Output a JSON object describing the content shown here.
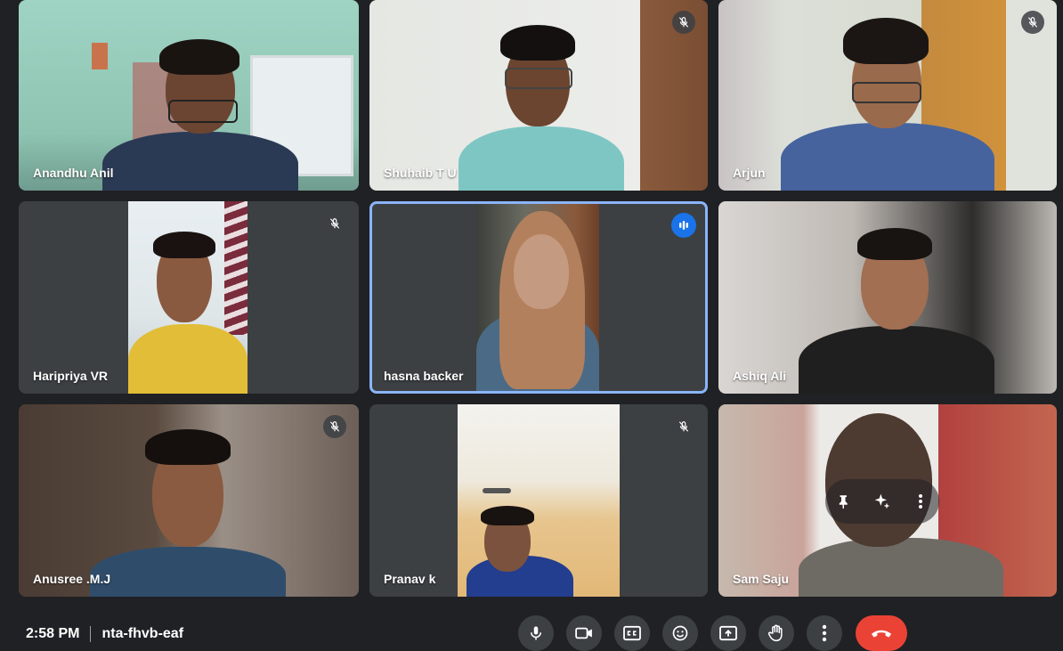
{
  "participants": [
    {
      "name": "Anandhu Anil",
      "muted": false
    },
    {
      "name": "Shuhaib T U",
      "muted": true
    },
    {
      "name": "Arjun",
      "muted": true
    },
    {
      "name": "Haripriya VR",
      "muted": true
    },
    {
      "name": "hasna backer",
      "muted": false,
      "speaking": true
    },
    {
      "name": "Ashiq Ali",
      "muted": false
    },
    {
      "name": "Anusree .M.J",
      "muted": true
    },
    {
      "name": "Pranav k",
      "muted": true
    },
    {
      "name": "Sam Saju",
      "muted": false
    }
  ],
  "meeting": {
    "time": "2:58 PM",
    "code": "nta-fhvb-eaf"
  },
  "controls": [
    "microphone-icon",
    "camera-icon",
    "captions-icon",
    "emoji-icon",
    "present-icon",
    "raise-hand-icon",
    "more-options-icon",
    "end-call-icon"
  ],
  "colors": {
    "background": "#202124",
    "tile": "#3c4043",
    "active_border": "#8ab4f8",
    "end_call": "#ea4335",
    "speaking": "#1a73e8"
  }
}
